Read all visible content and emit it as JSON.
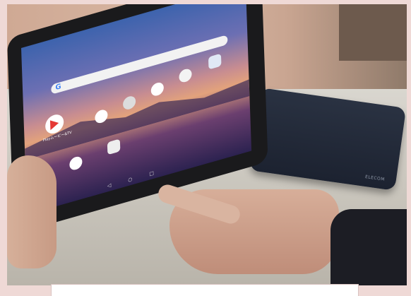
{
  "photo": {
    "description_items": {
      "play_app_label": "Playムービー&TV",
      "speaker_brand": "ELECOM"
    }
  },
  "colors": {
    "page_background": "#efd9d6",
    "caption_box": "#ffffff"
  }
}
